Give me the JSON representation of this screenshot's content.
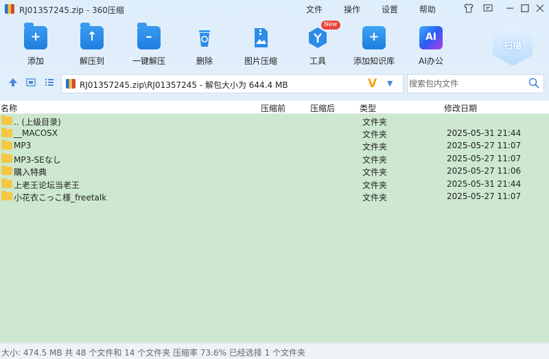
{
  "window": {
    "title": "RJ01357245.zip - 360压缩",
    "menu": [
      "文件",
      "操作",
      "设置",
      "帮助"
    ]
  },
  "toolbar": {
    "items": [
      {
        "label": "添加",
        "icon": "add-icon"
      },
      {
        "label": "解压到",
        "icon": "extract-to-icon"
      },
      {
        "label": "一键解压",
        "icon": "one-click-extract-icon"
      },
      {
        "label": "删除",
        "icon": "trash-icon"
      },
      {
        "label": "图片压缩",
        "icon": "image-compress-icon"
      },
      {
        "label": "工具",
        "icon": "tools-icon",
        "badge": "New"
      },
      {
        "label": "添加知识库",
        "icon": "knowledge-base-icon"
      },
      {
        "label": "AI办公",
        "icon": "ai-office-icon",
        "glyph": "AI"
      }
    ],
    "scan_label": "扫描"
  },
  "address": {
    "path": "RJ01357245.zip\\RJ01357245 - 解包大小为 644.4 MB",
    "search_placeholder": "搜索包内文件"
  },
  "columns": {
    "name": "名称",
    "before": "压缩前",
    "after": "压缩后",
    "type": "类型",
    "modified": "修改日期"
  },
  "files": [
    {
      "name": ".. (上级目录)",
      "type": "文件夹",
      "modified": ""
    },
    {
      "name": "__MACOSX",
      "type": "文件夹",
      "modified": "2025-05-31 21:44"
    },
    {
      "name": "MP3",
      "type": "文件夹",
      "modified": "2025-05-27 11:07"
    },
    {
      "name": "MP3-SEなし",
      "type": "文件夹",
      "modified": "2025-05-27 11:07"
    },
    {
      "name": "購入特典",
      "type": "文件夹",
      "modified": "2025-05-27 11:06"
    },
    {
      "name": "上老王论坛当老王",
      "type": "文件夹",
      "modified": "2025-05-31 21:44"
    },
    {
      "name": "小花衣こっこ様_freetalk",
      "type": "文件夹",
      "modified": "2025-05-27 11:07"
    }
  ],
  "status": "大小: 474.5 MB 共 48 个文件和 14 个文件夹 压缩率 73.6% 已经选择 1 个文件夹",
  "colors": {
    "accent": "#1f7ee0",
    "list_background": "#cde8cf",
    "folder": "#f6c744"
  }
}
